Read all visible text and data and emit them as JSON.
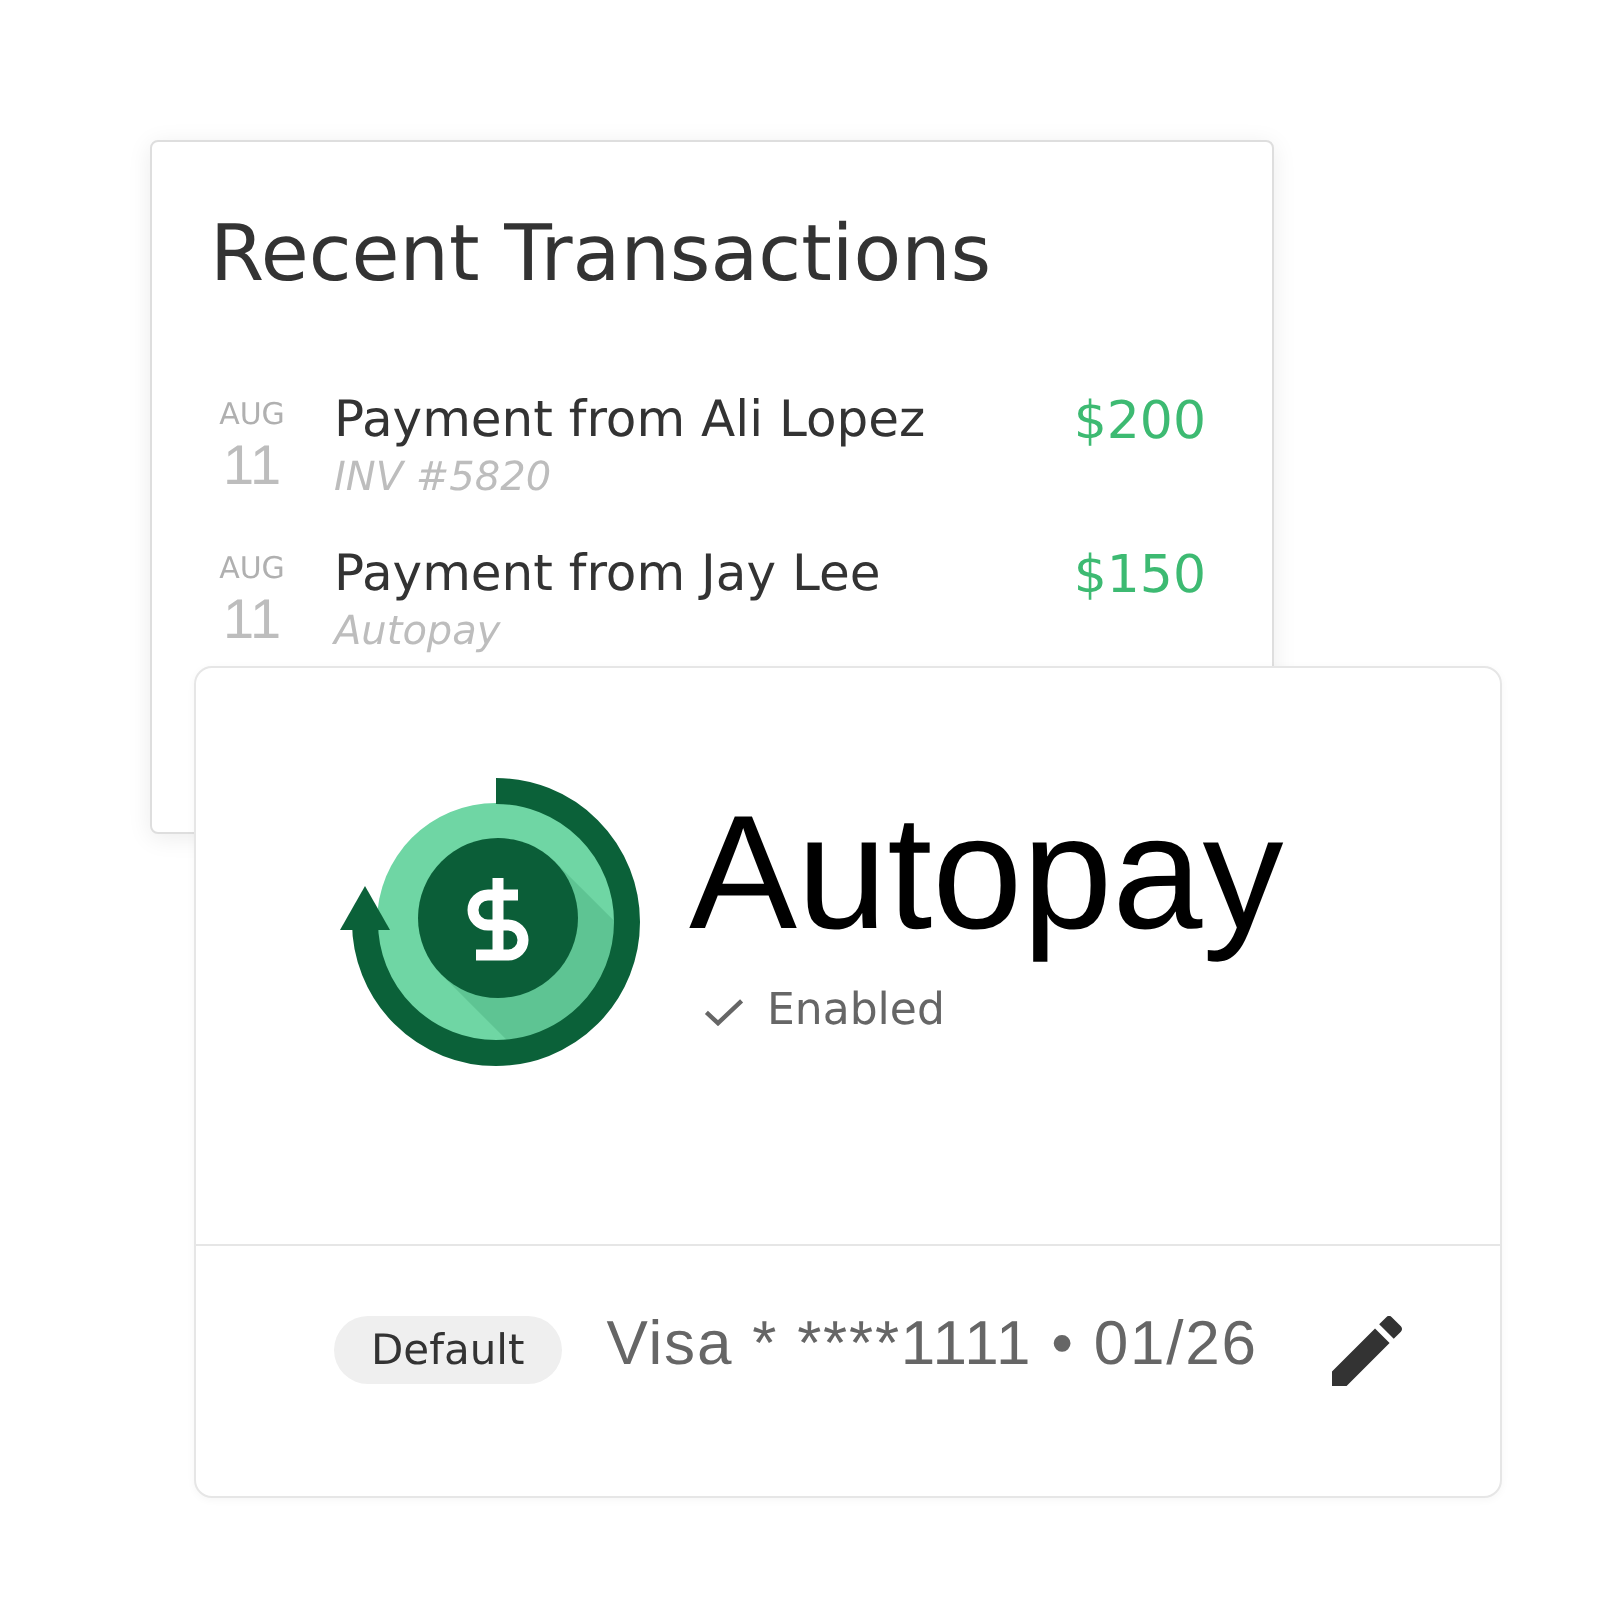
{
  "transactions_card": {
    "title": "Recent Transactions",
    "rows": [
      {
        "month": "AUG",
        "day": "11",
        "title": "Payment from Ali Lopez",
        "subtitle": "INV #5820",
        "amount": "$200"
      },
      {
        "month": "AUG",
        "day": "11",
        "title": "Payment from Jay Lee",
        "subtitle": "Autopay",
        "amount": "$150"
      }
    ]
  },
  "autopay_card": {
    "title": "Autopay",
    "status": {
      "label": "Enabled",
      "enabled": true
    },
    "payment_method": {
      "badge": "Default",
      "description": "Visa * ****1111 • 01/26"
    }
  }
}
